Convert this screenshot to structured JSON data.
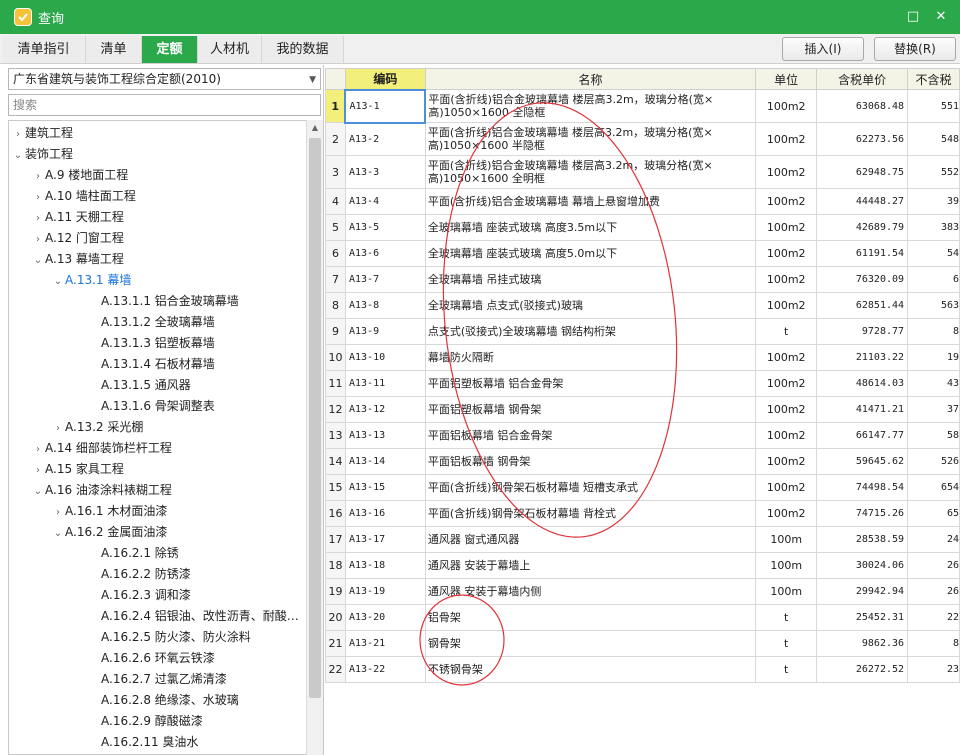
{
  "window": {
    "title": "查询",
    "close_glyph": "✕",
    "restore_glyph": "□"
  },
  "tabs": [
    {
      "label": "清单指引",
      "active": false
    },
    {
      "label": "清单",
      "active": false
    },
    {
      "label": "定额",
      "active": true
    },
    {
      "label": "人材机",
      "active": false
    },
    {
      "label": "我的数据",
      "active": false
    }
  ],
  "actions": {
    "insert": "插入(I)",
    "replace": "替换(R)"
  },
  "library": {
    "selected": "广东省建筑与装饰工程综合定额(2010)"
  },
  "search": {
    "placeholder": "搜索"
  },
  "tree": [
    {
      "label": "建筑工程",
      "level": 0,
      "arrow": "›"
    },
    {
      "label": "装饰工程",
      "level": 0,
      "arrow": "⌄"
    },
    {
      "label": "A.9 楼地面工程",
      "level": 1,
      "arrow": "›"
    },
    {
      "label": "A.10 墙柱面工程",
      "level": 1,
      "arrow": "›"
    },
    {
      "label": "A.11 天棚工程",
      "level": 1,
      "arrow": "›"
    },
    {
      "label": "A.12 门窗工程",
      "level": 1,
      "arrow": "›"
    },
    {
      "label": "A.13 幕墙工程",
      "level": 1,
      "arrow": "⌄"
    },
    {
      "label": "A.13.1 幕墙",
      "level": 2,
      "arrow": "⌄",
      "selected": true
    },
    {
      "label": "A.13.1.1 铝合金玻璃幕墙",
      "level": 3,
      "arrow": ""
    },
    {
      "label": "A.13.1.2 全玻璃幕墙",
      "level": 3,
      "arrow": ""
    },
    {
      "label": "A.13.1.3 铝塑板幕墙",
      "level": 3,
      "arrow": ""
    },
    {
      "label": "A.13.1.4 石板材幕墙",
      "level": 3,
      "arrow": ""
    },
    {
      "label": "A.13.1.5 通风器",
      "level": 3,
      "arrow": ""
    },
    {
      "label": "A.13.1.6 骨架调整表",
      "level": 3,
      "arrow": ""
    },
    {
      "label": "A.13.2 采光棚",
      "level": 2,
      "arrow": "›"
    },
    {
      "label": "A.14 细部装饰栏杆工程",
      "level": 1,
      "arrow": "›"
    },
    {
      "label": "A.15 家具工程",
      "level": 1,
      "arrow": "›"
    },
    {
      "label": "A.16 油漆涂料裱糊工程",
      "level": 1,
      "arrow": "⌄"
    },
    {
      "label": "A.16.1 木材面油漆",
      "level": 2,
      "arrow": "›"
    },
    {
      "label": "A.16.2 金属面油漆",
      "level": 2,
      "arrow": "⌄"
    },
    {
      "label": "A.16.2.1 除锈",
      "level": 3,
      "arrow": ""
    },
    {
      "label": "A.16.2.2 防锈漆",
      "level": 3,
      "arrow": ""
    },
    {
      "label": "A.16.2.3 调和漆",
      "level": 3,
      "arrow": ""
    },
    {
      "label": "A.16.2.4 铝银油、改性沥青、耐酸…",
      "level": 3,
      "arrow": ""
    },
    {
      "label": "A.16.2.5 防火漆、防火涂料",
      "level": 3,
      "arrow": ""
    },
    {
      "label": "A.16.2.6 环氧云铁漆",
      "level": 3,
      "arrow": ""
    },
    {
      "label": "A.16.2.7 过氯乙烯清漆",
      "level": 3,
      "arrow": ""
    },
    {
      "label": "A.16.2.8 绝缘漆、水玻璃",
      "level": 3,
      "arrow": ""
    },
    {
      "label": "A.16.2.9 醇酸磁漆",
      "level": 3,
      "arrow": ""
    },
    {
      "label": "A.16.2.11 臭油水",
      "level": 3,
      "arrow": ""
    }
  ],
  "grid": {
    "headers": {
      "num": "",
      "code": "编码",
      "name": "名称",
      "unit": "单位",
      "price": "含税单价",
      "notax": "不含税"
    },
    "rows": [
      {
        "num": "1",
        "code": "A13-1",
        "name": "平面(含折线)铝合金玻璃幕墙 楼层高3.2m，玻璃分格(宽×高)1050×1600 全隐框",
        "unit": "100m2",
        "price": "63068.48",
        "notax": "551"
      },
      {
        "num": "2",
        "code": "A13-2",
        "name": "平面(含折线)铝合金玻璃幕墙 楼层高3.2m，玻璃分格(宽×高)1050×1600 半隐框",
        "unit": "100m2",
        "price": "62273.56",
        "notax": "548"
      },
      {
        "num": "3",
        "code": "A13-3",
        "name": "平面(含折线)铝合金玻璃幕墙 楼层高3.2m，玻璃分格(宽×高)1050×1600 全明框",
        "unit": "100m2",
        "price": "62948.75",
        "notax": "552"
      },
      {
        "num": "4",
        "code": "A13-4",
        "name": "平面(含折线)铝合金玻璃幕墙 幕墙上悬窗增加费",
        "unit": "100m2",
        "price": "44448.27",
        "notax": "39"
      },
      {
        "num": "5",
        "code": "A13-5",
        "name": "全玻璃幕墙 座装式玻璃 高度3.5m以下",
        "unit": "100m2",
        "price": "42689.79",
        "notax": "383"
      },
      {
        "num": "6",
        "code": "A13-6",
        "name": "全玻璃幕墙 座装式玻璃 高度5.0m以下",
        "unit": "100m2",
        "price": "61191.54",
        "notax": "54"
      },
      {
        "num": "7",
        "code": "A13-7",
        "name": "全玻璃幕墙 吊挂式玻璃",
        "unit": "100m2",
        "price": "76320.09",
        "notax": "6"
      },
      {
        "num": "8",
        "code": "A13-8",
        "name": "全玻璃幕墙 点支式(驳接式)玻璃",
        "unit": "100m2",
        "price": "62851.44",
        "notax": "563"
      },
      {
        "num": "9",
        "code": "A13-9",
        "name": "点支式(驳接式)全玻璃幕墙 钢结构桁架",
        "unit": "t",
        "price": "9728.77",
        "notax": "8"
      },
      {
        "num": "10",
        "code": "A13-10",
        "name": "幕墙防火隔断",
        "unit": "100m2",
        "price": "21103.22",
        "notax": "19"
      },
      {
        "num": "11",
        "code": "A13-11",
        "name": "平面铝塑板幕墙 铝合金骨架",
        "unit": "100m2",
        "price": "48614.03",
        "notax": "43"
      },
      {
        "num": "12",
        "code": "A13-12",
        "name": "平面铝塑板幕墙 钢骨架",
        "unit": "100m2",
        "price": "41471.21",
        "notax": "37"
      },
      {
        "num": "13",
        "code": "A13-13",
        "name": "平面铝板幕墙 铝合金骨架",
        "unit": "100m2",
        "price": "66147.77",
        "notax": "58"
      },
      {
        "num": "14",
        "code": "A13-14",
        "name": "平面铝板幕墙 钢骨架",
        "unit": "100m2",
        "price": "59645.62",
        "notax": "526"
      },
      {
        "num": "15",
        "code": "A13-15",
        "name": "平面(含折线)钢骨架石板材幕墙 短槽支承式",
        "unit": "100m2",
        "price": "74498.54",
        "notax": "654"
      },
      {
        "num": "16",
        "code": "A13-16",
        "name": "平面(含折线)钢骨架石板材幕墙 背栓式",
        "unit": "100m2",
        "price": "74715.26",
        "notax": "65"
      },
      {
        "num": "17",
        "code": "A13-17",
        "name": "通风器 窗式通风器",
        "unit": "100m",
        "price": "28538.59",
        "notax": "24"
      },
      {
        "num": "18",
        "code": "A13-18",
        "name": "通风器 安装于幕墙上",
        "unit": "100m",
        "price": "30024.06",
        "notax": "26"
      },
      {
        "num": "19",
        "code": "A13-19",
        "name": "通风器 安装于幕墙内侧",
        "unit": "100m",
        "price": "29942.94",
        "notax": "26"
      },
      {
        "num": "20",
        "code": "A13-20",
        "name": "铝骨架",
        "unit": "t",
        "price": "25452.31",
        "notax": "22"
      },
      {
        "num": "21",
        "code": "A13-21",
        "name": "钢骨架",
        "unit": "t",
        "price": "9862.36",
        "notax": "8"
      },
      {
        "num": "22",
        "code": "A13-22",
        "name": "不锈钢骨架",
        "unit": "t",
        "price": "26272.52",
        "notax": "23"
      }
    ]
  },
  "colors": {
    "accent": "#2aa84a",
    "highlight": "#f2ef7a",
    "annotation": "#e0323a",
    "selected_tree": "#1a73d9"
  }
}
